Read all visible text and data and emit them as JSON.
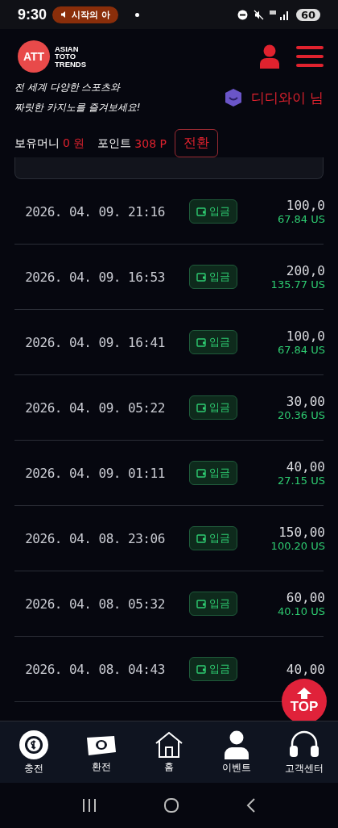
{
  "status_bar": {
    "time": "9:30",
    "media_pill": "시작의 아",
    "battery": "60"
  },
  "header": {
    "logo_mark": "ATT",
    "logo_text": [
      "ASIAN",
      "TOTO",
      "TRENDS"
    ],
    "tagline": [
      "전 세계 다양한 스포츠와",
      "짜릿한 카지노를 즐겨보세요!"
    ],
    "username": "디디와이 님"
  },
  "balance": {
    "money_label": "보유머니",
    "money_value": "0 원",
    "point_label": "포인트",
    "point_value": "308 P",
    "convert_button": "전환"
  },
  "rows": [
    {
      "datetime": "2026. 04. 09. 21:16",
      "type": "입금",
      "amount": "100,0",
      "usd": "67.84 US"
    },
    {
      "datetime": "2026. 04. 09. 16:53",
      "type": "입금",
      "amount": "200,0",
      "usd": "135.77 US"
    },
    {
      "datetime": "2026. 04. 09. 16:41",
      "type": "입금",
      "amount": "100,0",
      "usd": "67.84 US"
    },
    {
      "datetime": "2026. 04. 09. 05:22",
      "type": "입금",
      "amount": "30,00",
      "usd": "20.36 US"
    },
    {
      "datetime": "2026. 04. 09. 01:11",
      "type": "입금",
      "amount": "40,00",
      "usd": "27.15 US"
    },
    {
      "datetime": "2026. 04. 08. 23:06",
      "type": "입금",
      "amount": "150,00",
      "usd": "100.20 US"
    },
    {
      "datetime": "2026. 04. 08. 05:32",
      "type": "입금",
      "amount": "60,00",
      "usd": "40.10 US"
    },
    {
      "datetime": "2026. 04. 08. 04:43",
      "type": "입금",
      "amount": "40,00"
    }
  ],
  "top_button": "TOP",
  "bottom_nav": [
    {
      "label": "충전",
      "kind": "chip"
    },
    {
      "label": "환전",
      "kind": "cash"
    },
    {
      "label": "홈",
      "kind": "home"
    },
    {
      "label": "이벤트",
      "kind": "person"
    },
    {
      "label": "고객센터",
      "kind": "headset"
    }
  ]
}
